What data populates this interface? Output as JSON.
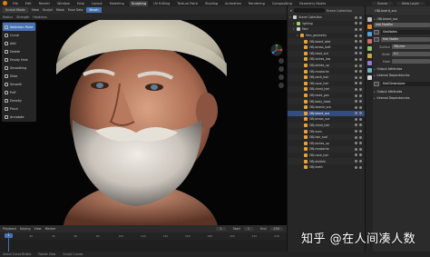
{
  "topbar": {
    "menus": [
      "File",
      "Edit",
      "Render",
      "Window",
      "Help"
    ],
    "workspaces": [
      "Layout",
      "Modeling",
      "Sculpting",
      "UV Editing",
      "Texture Paint",
      "Shading",
      "Animation",
      "Rendering",
      "Compositing",
      "Geometry Nodes"
    ],
    "active_workspace": "Sculpting",
    "scene_label": "Scene",
    "view_layer_label": "View Layer"
  },
  "viewport_header": {
    "mode": "Sculpt Mode",
    "menus": [
      "View",
      "Sculpt",
      "Mask",
      "Face Sets"
    ],
    "tool_label": "Brush",
    "options": [
      "Radius",
      "Strength",
      "Hardness"
    ]
  },
  "toolbar": {
    "tools": [
      {
        "label": "Selection Point",
        "icon": "pointer-icon"
      },
      {
        "label": "Curve",
        "icon": "curve-icon"
      },
      {
        "label": "Add",
        "icon": "add-icon"
      },
      {
        "label": "Delete",
        "icon": "delete-icon"
      },
      {
        "label": "Empty Hole",
        "icon": "hole-icon"
      },
      {
        "label": "Smoothing",
        "icon": "smooth-icon"
      },
      {
        "label": "Slide",
        "icon": "slide-icon"
      },
      {
        "label": "Smooth",
        "icon": "smooth-brush-icon"
      },
      {
        "label": "Puff",
        "icon": "puff-icon"
      },
      {
        "label": "Density",
        "icon": "density-icon"
      },
      {
        "label": "Pinch",
        "icon": "pinch-icon"
      },
      {
        "label": "Annotate",
        "icon": "annotate-icon"
      }
    ]
  },
  "outliner": {
    "header": "Scene Collection",
    "rows": [
      {
        "name": "Scene Collection",
        "indent": 0,
        "color": "#cfcfcf",
        "selected": false
      },
      {
        "name": "lighting",
        "indent": 1,
        "color": "#9ad06a",
        "selected": false
      },
      {
        "name": "Man",
        "indent": 1,
        "color": "#cfcfcf",
        "selected": false
      },
      {
        "name": "Man_geometry",
        "indent": 2,
        "color": "#e8a23a",
        "selected": false
      },
      {
        "name": "OBJ.beard_side",
        "indent": 3,
        "color": "#e8a23a",
        "selected": false
      },
      {
        "name": "OBJ.brows_bott",
        "indent": 3,
        "color": "#e8a23a",
        "selected": false
      },
      {
        "name": "OBJ.head_out",
        "indent": 3,
        "color": "#e8a23a",
        "selected": false
      },
      {
        "name": "OBJ.lashes_low",
        "indent": 3,
        "color": "#e8a23a",
        "selected": false
      },
      {
        "name": "OBJ.lashes_up",
        "indent": 3,
        "color": "#e8a23a",
        "selected": false
      },
      {
        "name": "OBJ.mustache",
        "indent": 3,
        "color": "#e8a23a",
        "selected": false
      },
      {
        "name": "OBJ.neck_hair",
        "indent": 3,
        "color": "#e8a23a",
        "selected": false
      },
      {
        "name": "OBJ.nose_hair",
        "indent": 3,
        "color": "#e8a23a",
        "selected": false
      },
      {
        "name": "OBJ.chest_hair",
        "indent": 3,
        "color": "#e8a23a",
        "selected": false
      },
      {
        "name": "OBJ.head_geo",
        "indent": 3,
        "color": "#e8a23a",
        "selected": false
      },
      {
        "name": "OBJ.body_head",
        "indent": 3,
        "color": "#e8a23a",
        "selected": false
      },
      {
        "name": "OBJ.beanie_sca",
        "indent": 3,
        "color": "#e8a23a",
        "selected": false
      },
      {
        "name": "OBJ.beard_sca",
        "indent": 3,
        "color": "#e8a23a",
        "selected": true
      },
      {
        "name": "OBJ.brows_sca",
        "indent": 3,
        "color": "#e8a23a",
        "selected": false
      },
      {
        "name": "OBJ.chest_hair",
        "indent": 3,
        "color": "#e8a23a",
        "selected": false
      },
      {
        "name": "OBJ.eyes",
        "indent": 3,
        "color": "#e8a23a",
        "selected": false
      },
      {
        "name": "OBJ.hair_scal",
        "indent": 3,
        "color": "#e8a23a",
        "selected": false
      },
      {
        "name": "OBJ.lashes_up",
        "indent": 3,
        "color": "#e8a23a",
        "selected": false
      },
      {
        "name": "OBJ.mustache",
        "indent": 3,
        "color": "#e8a23a",
        "selected": false
      },
      {
        "name": "OBJ.nose_hair",
        "indent": 3,
        "color": "#e8a23a",
        "selected": false
      },
      {
        "name": "OBJ.stubble",
        "indent": 3,
        "color": "#e8a23a",
        "selected": false
      },
      {
        "name": "OBJ.teeth",
        "indent": 3,
        "color": "#e8a23a",
        "selected": false
      }
    ]
  },
  "properties": {
    "header": "OBJ.beard_sca",
    "tab_colors": [
      "#bdbdbd",
      "#e0893a",
      "#5a9fd4",
      "#d46a6a",
      "#8ac46a",
      "#c4a84a",
      "#9a7ad4",
      "#6ab4c4",
      "#d4d4d4"
    ],
    "breadcrumb": "OBJ.beard_sca",
    "modifier_label": "Add Modifier",
    "fields": [
      {
        "label": "",
        "value": "GeoNodes"
      },
      {
        "label": "",
        "value": "Hair Nodes"
      },
      {
        "label": "Surface",
        "value": "OBJ.hea"
      },
      {
        "label": "Width",
        "value": "0.1"
      },
      {
        "label": "Mask",
        "value": ""
      }
    ],
    "sections": [
      "Output Attributes",
      "Internal Dependencies"
    ],
    "modifier2": "HairDimensions",
    "sections2": [
      "Output Attributes",
      "Internal Dependencies"
    ]
  },
  "timeline": {
    "menus": [
      "Playback",
      "Keying",
      "View",
      "Marker"
    ],
    "current_frame": "1",
    "start_label": "Start",
    "start": "1",
    "end_label": "End",
    "end": "250",
    "ruler_ticks": [
      "0",
      "20",
      "40",
      "60",
      "80",
      "100",
      "120",
      "140",
      "160",
      "180",
      "200",
      "220",
      "240"
    ]
  },
  "status": {
    "items": [
      "Select Curve Bristle",
      "Rotate View",
      "Sculpt Curves"
    ]
  },
  "watermark": "知乎 @在人间凑人数",
  "colors": {
    "accent": "#4772b3",
    "collection_orange": "#e8a23a",
    "selected_row": "#334d80"
  }
}
